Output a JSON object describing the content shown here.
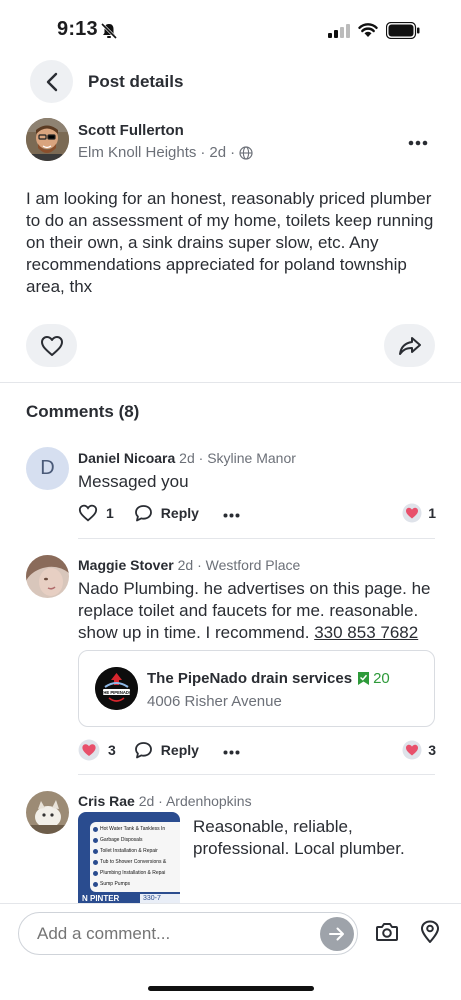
{
  "status": {
    "time": "9:13"
  },
  "header": {
    "title": "Post details"
  },
  "post": {
    "author": "Scott Fullerton",
    "neighborhood": "Elm Knoll Heights",
    "age": "2d",
    "body": "I am looking for an honest, reasonably priced plumber to do an assessment of my home, toilets keep running on their own, a sink drains super slow, etc.  Any recommendations appreciated for poland township area, thx"
  },
  "comments_section": {
    "title": "Comments (8)"
  },
  "comments": [
    {
      "initial": "D",
      "name": "Daniel Nicoara",
      "age": "2d",
      "neighborhood": "Skyline Manor",
      "text": "Messaged you",
      "likes": "1",
      "reply_label": "Reply",
      "reaction_count": "1"
    },
    {
      "name": "Maggie Stover",
      "age": "2d",
      "neighborhood": "Westford Place",
      "text": "Nado Plumbing. he advertises on this page. he replace toilet and faucets for me. reasonable. show up in time. I recommend. ",
      "phone": "330 853 7682",
      "business": {
        "name": "The PipeNado drain services",
        "recommendations": "20",
        "address": "4006 Risher Avenue",
        "logo_text": "THE PIPENADO"
      },
      "reaction_badge_count": "3",
      "reply_label": "Reply",
      "reaction_count": "3"
    },
    {
      "name": "Cris Rae",
      "age": "2d",
      "neighborhood": "Ardenhopkins",
      "text": "Reasonable, reliable, professional. Local plumber.",
      "flyer": {
        "items": [
          "Hot Water Tank & Tankless In",
          "Garbage Disposals",
          "Toilet Installation & Repair",
          "Tub to Shower Conversions &",
          "Plumbing Installation & Repai",
          "Sump Pumps"
        ],
        "banner": "N PINTER",
        "phone_fragment": "330-7"
      }
    }
  ],
  "composer": {
    "placeholder": "Add a comment..."
  },
  "icons": {
    "back": "chevron-left-icon",
    "more": "more-horizontal-icon",
    "globe": "globe-icon",
    "like": "heart-icon",
    "share": "share-icon",
    "reply": "speech-bubble-icon",
    "camera": "camera-icon",
    "location": "map-pin-icon",
    "send": "arrow-right-icon"
  },
  "colors": {
    "accent_green": "#2e9a3a",
    "reaction_pink": "#e8506b"
  }
}
